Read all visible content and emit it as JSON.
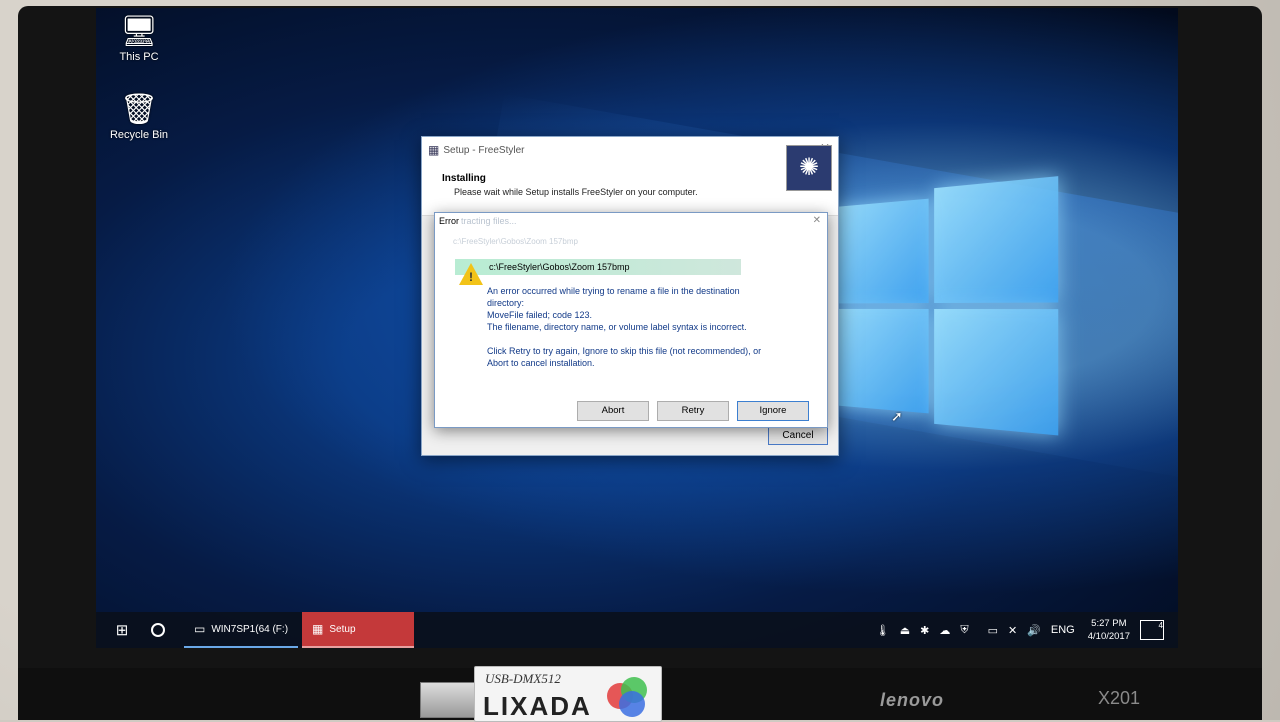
{
  "desktop": {
    "icons": [
      {
        "label": "This PC",
        "icon": "computer-icon"
      },
      {
        "label": "Recycle Bin",
        "icon": "recycle-bin-icon"
      }
    ]
  },
  "setup_window": {
    "title": "Setup - FreeStyler",
    "heading": "Installing",
    "subheading": "Please wait while Setup installs FreeStyler on your computer.",
    "cancel_label": "Cancel"
  },
  "error_dialog": {
    "title": "Error",
    "ghost_title": "tracting files...",
    "ghost_path": "c:\\FreeStyler\\Gobos\\Zoom 157bmp",
    "file_path": "c:\\FreeStyler\\Gobos\\Zoom 157bmp",
    "message_lines": [
      "An error occurred while trying to rename a file in the destination",
      "directory:",
      "MoveFile failed; code 123.",
      "The filename, directory name, or volume label syntax is incorrect."
    ],
    "instruction_lines": [
      "Click Retry to try again, Ignore to skip this file (not recommended), or",
      "Abort to cancel installation."
    ],
    "buttons": {
      "abort": "Abort",
      "retry": "Retry",
      "ignore": "Ignore"
    }
  },
  "taskbar": {
    "items": [
      {
        "label": "WIN7SP1(64 (F:)",
        "icon": "drive-icon"
      },
      {
        "label": "Setup",
        "icon": "setup-icon"
      }
    ],
    "language": "ENG",
    "time": "5:27 PM",
    "date": "4/10/2017",
    "notification_count": "4"
  },
  "hardware": {
    "brand": "lenovo",
    "model": "X201",
    "usb_label": "USB-DMX512",
    "usb_brand": "LIXADA"
  },
  "colors": {
    "taskbar_active": "#c4393a",
    "error_path_highlight": "#b8ecd3",
    "warning": "#f2c318"
  }
}
